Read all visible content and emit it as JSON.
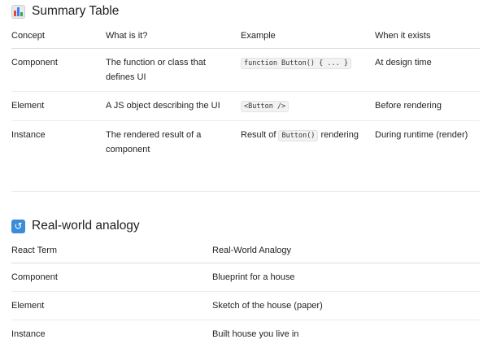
{
  "summary": {
    "title": "Summary Table",
    "icon": "bar-chart-icon",
    "headers": [
      "Concept",
      "What is it?",
      "Example",
      "When it exists"
    ],
    "rows": [
      {
        "concept": "Component",
        "what": "The function or class that defines UI",
        "example_code": "function Button() { ... }",
        "when": "At design time"
      },
      {
        "concept": "Element",
        "what": "A JS object describing the UI",
        "example_code": "<Button />",
        "when": "Before rendering"
      },
      {
        "concept": "Instance",
        "what": "The rendered result of a component",
        "example_prefix": "Result of",
        "example_code": "Button()",
        "example_suffix": "rendering",
        "when": "During runtime (render)"
      }
    ]
  },
  "analogy": {
    "title": "Real-world analogy",
    "icon": "repeat-icon",
    "headers": [
      "React Term",
      "Real-World Analogy"
    ],
    "rows": [
      {
        "term": "Component",
        "analogy": "Blueprint for a house"
      },
      {
        "term": "Element",
        "analogy": "Sketch of the house (paper)"
      },
      {
        "term": "Instance",
        "analogy": "Built house you live in"
      }
    ]
  }
}
